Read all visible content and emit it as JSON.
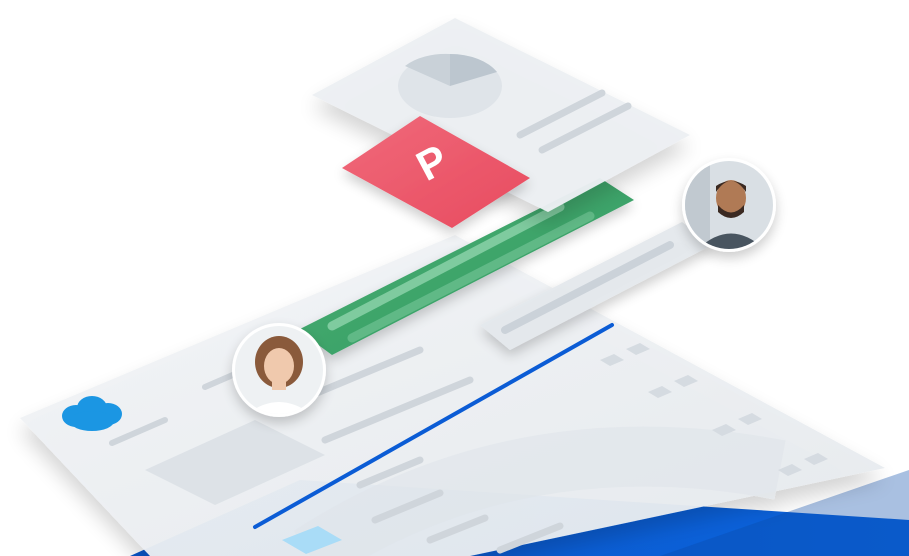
{
  "illustration": {
    "badge_letter": "P",
    "colors": {
      "brand_blue": "#0b5cd5",
      "brand_blue_dark": "#0a4aa8",
      "cloud_blue": "#1b96e3",
      "badge_red": "#ee5a6b",
      "message_green": "#3fa66b",
      "panel_grey": "#e7ebef",
      "skeleton_grey": "#cfd5db",
      "pie_grey": "#bcc6cf"
    },
    "icons": {
      "logo": "cloud-logo-icon",
      "badge": "p-badge-icon",
      "chart": "pie-chart-icon",
      "woman": "avatar-woman",
      "man": "avatar-man"
    }
  }
}
